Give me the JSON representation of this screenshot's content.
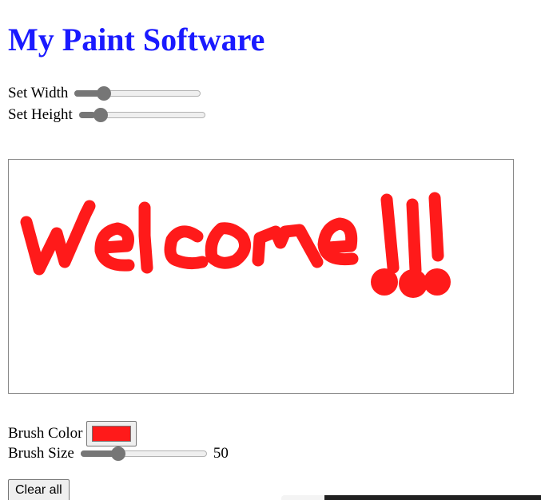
{
  "title": "My Paint Software",
  "controls": {
    "width_label": "Set Width",
    "width_level": 0.2,
    "height_label": "Set Height",
    "height_level": 0.13,
    "brush_color_label": "Brush Color",
    "brush_color": "#ff1a1a",
    "brush_size_label": "Brush Size",
    "brush_size_value": "50",
    "brush_size_level": 0.27,
    "clear_label": "Clear all"
  },
  "canvas": {
    "drawing_text": "Welcome!!!",
    "stroke_color": "#ff1a1a"
  },
  "colors": {
    "title": "#1a1aff",
    "slider_fill": "#767676"
  }
}
